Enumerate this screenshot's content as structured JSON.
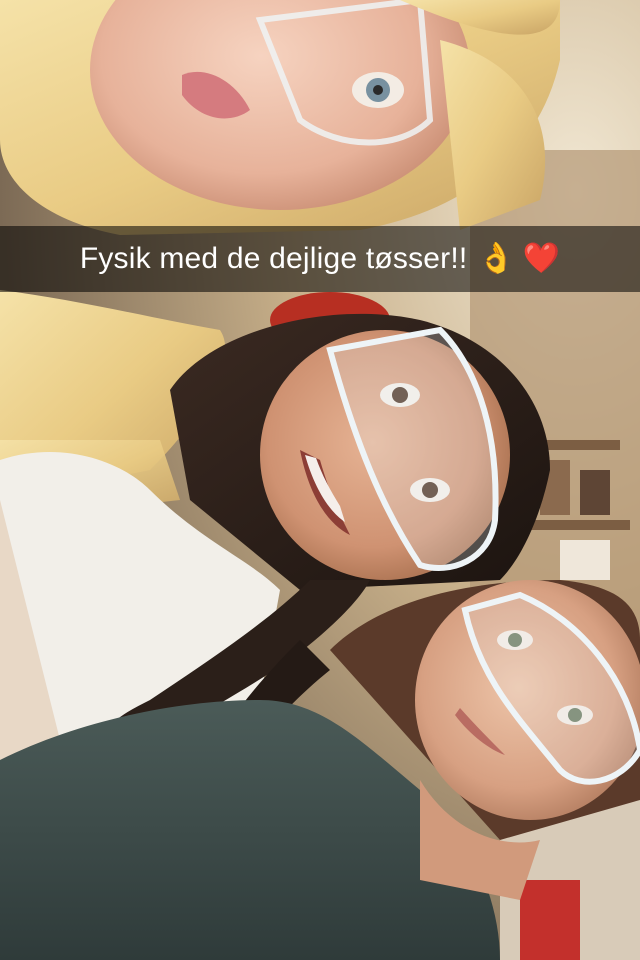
{
  "snap": {
    "caption": "Fysik med de dejlige tøsser!!",
    "caption_emojis": [
      "👌",
      "❤️"
    ],
    "colors": {
      "caption_bar": "rgba(0,0,0,0.55)",
      "caption_text": "#ffffff",
      "heart": "#d8191f"
    }
  }
}
